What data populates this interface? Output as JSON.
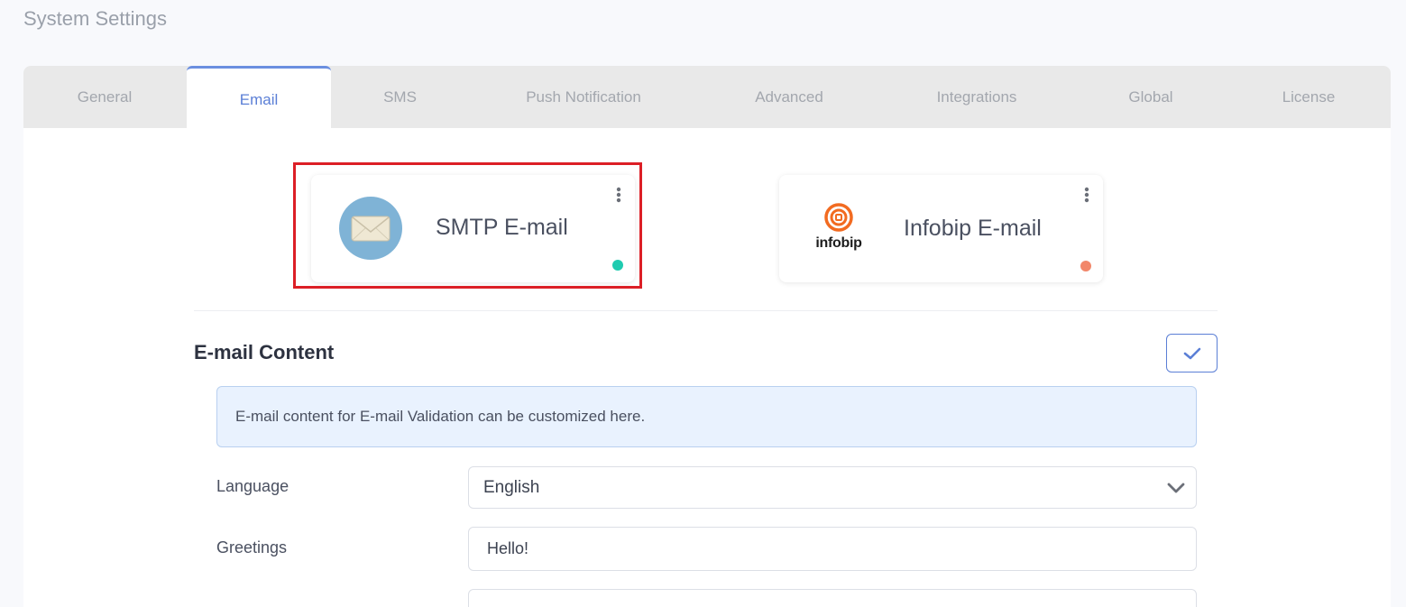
{
  "page": {
    "title": "System Settings"
  },
  "tabs": [
    {
      "label": "General"
    },
    {
      "label": "Email",
      "active": true
    },
    {
      "label": "SMS"
    },
    {
      "label": "Push Notification"
    },
    {
      "label": "Advanced"
    },
    {
      "label": "Integrations"
    },
    {
      "label": "Global"
    },
    {
      "label": "License"
    }
  ],
  "providers": {
    "smtp": {
      "name": "SMTP E-mail",
      "icon": "envelope-icon",
      "status_color": "#1fcbb0"
    },
    "infobip": {
      "name": "Infobip E-mail",
      "logo_text": "infobip",
      "icon": "infobip-logo",
      "status_color": "#f2876a"
    }
  },
  "email_content": {
    "title": "E-mail Content",
    "info": "E-mail content for E-mail Validation can be customized here.",
    "language_label": "Language",
    "language_value": "English",
    "greetings_label": "Greetings",
    "greetings_value": "Hello!"
  },
  "colors": {
    "accent": "#5b7fd6",
    "highlight": "#dc1f26"
  }
}
